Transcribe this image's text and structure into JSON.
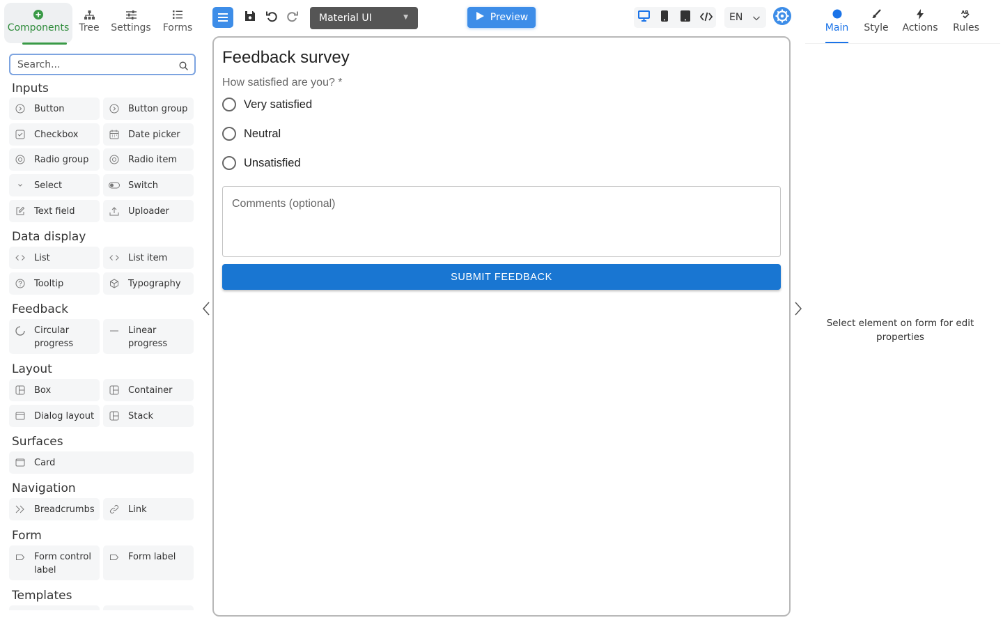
{
  "left_tabs": [
    {
      "label": "Components",
      "icon": "plus-circle-icon",
      "active": true
    },
    {
      "label": "Tree",
      "icon": "tree-icon",
      "active": false
    },
    {
      "label": "Settings",
      "icon": "sliders-icon",
      "active": false
    },
    {
      "label": "Forms",
      "icon": "list-icon",
      "active": false
    }
  ],
  "search": {
    "placeholder": "Search...",
    "value": ""
  },
  "groups": [
    {
      "title": "Inputs",
      "items": [
        {
          "label": "Button",
          "icon": "button-icon"
        },
        {
          "label": "Button group",
          "icon": "button-group-icon"
        },
        {
          "label": "Checkbox",
          "icon": "checkbox-icon"
        },
        {
          "label": "Date picker",
          "icon": "calendar-icon"
        },
        {
          "label": "Radio group",
          "icon": "radio-icon"
        },
        {
          "label": "Radio item",
          "icon": "radio-icon"
        },
        {
          "label": "Select",
          "icon": "chevron-down-icon"
        },
        {
          "label": "Switch",
          "icon": "toggle-icon"
        },
        {
          "label": "Text field",
          "icon": "edit-icon"
        },
        {
          "label": "Uploader",
          "icon": "upload-icon"
        }
      ]
    },
    {
      "title": "Data display",
      "items": [
        {
          "label": "List",
          "icon": "code-icon"
        },
        {
          "label": "List item",
          "icon": "code-icon"
        },
        {
          "label": "Tooltip",
          "icon": "help-icon"
        },
        {
          "label": "Typography",
          "icon": "cube-icon"
        }
      ]
    },
    {
      "title": "Feedback",
      "items": [
        {
          "label": "Circular progress",
          "icon": "spinner-icon"
        },
        {
          "label": "Linear progress",
          "icon": "minus-icon"
        }
      ]
    },
    {
      "title": "Layout",
      "items": [
        {
          "label": "Box",
          "icon": "layout-icon"
        },
        {
          "label": "Container",
          "icon": "layout-icon"
        },
        {
          "label": "Dialog layout",
          "icon": "window-icon"
        },
        {
          "label": "Stack",
          "icon": "layout-icon"
        }
      ]
    },
    {
      "title": "Surfaces",
      "items": [
        {
          "label": "Card",
          "icon": "window-icon"
        }
      ]
    },
    {
      "title": "Navigation",
      "items": [
        {
          "label": "Breadcrumbs",
          "icon": "double-chevron-icon"
        },
        {
          "label": "Link",
          "icon": "link-icon"
        }
      ]
    },
    {
      "title": "Form",
      "items": [
        {
          "label": "Form control label",
          "icon": "tag-icon"
        },
        {
          "label": "Form label",
          "icon": "tag-icon"
        }
      ]
    },
    {
      "title": "Templates",
      "items": []
    }
  ],
  "toolbar": {
    "theme_select": "Material UI",
    "preview_label": "Preview",
    "language": "EN",
    "accent": "#3d8de8"
  },
  "form": {
    "title": "Feedback survey",
    "question": "How satisfied are you? *",
    "options": [
      "Very satisfied",
      "Neutral",
      "Unsatisfied"
    ],
    "comments_placeholder": "Comments (optional)",
    "comments_value": "",
    "submit_label": "SUBMIT FEEDBACK",
    "submit_color": "#1976d2"
  },
  "right_tabs": [
    {
      "label": "Main",
      "icon": "dot-icon",
      "active": true
    },
    {
      "label": "Style",
      "icon": "brush-icon",
      "active": false
    },
    {
      "label": "Actions",
      "icon": "bolt-icon",
      "active": false
    },
    {
      "label": "Rules",
      "icon": "rules-icon",
      "active": false
    }
  ],
  "properties_empty_message": "Select element on form for edit properties"
}
